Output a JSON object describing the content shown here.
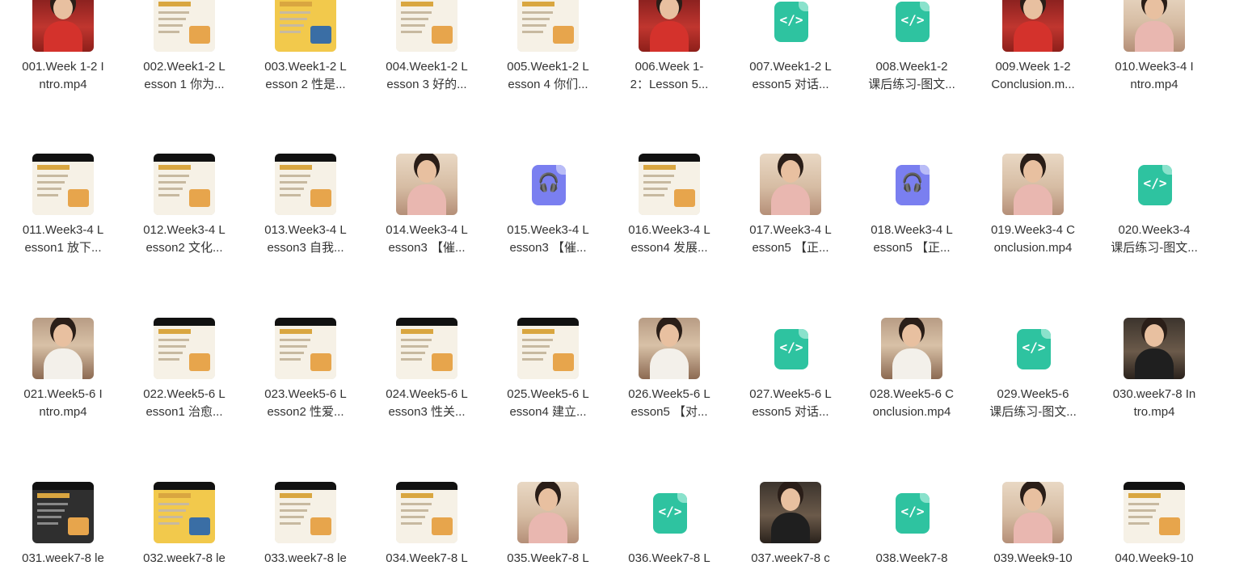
{
  "files": [
    {
      "line1": "001.Week 1-2 I",
      "line2": "ntro.mp4",
      "type": "video",
      "style": "person red"
    },
    {
      "line1": "002.Week1-2 L",
      "line2": "esson 1 你为...",
      "type": "video",
      "style": "slide"
    },
    {
      "line1": "003.Week1-2 L",
      "line2": "esson 2 性是...",
      "type": "video",
      "style": "slide yellow"
    },
    {
      "line1": "004.Week1-2 L",
      "line2": "esson 3 好的...",
      "type": "video",
      "style": "slide"
    },
    {
      "line1": "005.Week1-2 L",
      "line2": "esson 4 你们...",
      "type": "video",
      "style": "slide"
    },
    {
      "line1": "006.Week 1-",
      "line2": "2：Lesson 5...",
      "type": "video",
      "style": "person red"
    },
    {
      "line1": "007.Week1-2 L",
      "line2": "esson5 对话...",
      "type": "code"
    },
    {
      "line1": "008.Week1-2",
      "line2": "课后练习-图文...",
      "type": "code"
    },
    {
      "line1": "009.Week 1-2",
      "line2": "Conclusion.m...",
      "type": "video",
      "style": "person red"
    },
    {
      "line1": "010.Week3-4 I",
      "line2": "ntro.mp4",
      "type": "video",
      "style": "person light"
    },
    {
      "line1": "011.Week3-4 L",
      "line2": "esson1 放下...",
      "type": "video",
      "style": "slide"
    },
    {
      "line1": "012.Week3-4 L",
      "line2": "esson2 文化...",
      "type": "video",
      "style": "slide"
    },
    {
      "line1": "013.Week3-4 L",
      "line2": "esson3 自我...",
      "type": "video",
      "style": "slide"
    },
    {
      "line1": "014.Week3-4 L",
      "line2": "esson3 【催...",
      "type": "video",
      "style": "person light"
    },
    {
      "line1": "015.Week3-4 L",
      "line2": "esson3 【催...",
      "type": "audio"
    },
    {
      "line1": "016.Week3-4 L",
      "line2": "esson4 发展...",
      "type": "video",
      "style": "slide"
    },
    {
      "line1": "017.Week3-4 L",
      "line2": "esson5 【正...",
      "type": "video",
      "style": "person light"
    },
    {
      "line1": "018.Week3-4 L",
      "line2": "esson5 【正...",
      "type": "audio"
    },
    {
      "line1": "019.Week3-4 C",
      "line2": "onclusion.mp4",
      "type": "video",
      "style": "person light"
    },
    {
      "line1": "020.Week3-4",
      "line2": "课后练习-图文...",
      "type": "code"
    },
    {
      "line1": "021.Week5-6 I",
      "line2": "ntro.mp4",
      "type": "video",
      "style": "person"
    },
    {
      "line1": "022.Week5-6 L",
      "line2": "esson1 治愈...",
      "type": "video",
      "style": "slide"
    },
    {
      "line1": "023.Week5-6 L",
      "line2": "esson2 性爱...",
      "type": "video",
      "style": "slide"
    },
    {
      "line1": "024.Week5-6 L",
      "line2": "esson3 性关...",
      "type": "video",
      "style": "slide"
    },
    {
      "line1": "025.Week5-6 L",
      "line2": "esson4 建立...",
      "type": "video",
      "style": "slide"
    },
    {
      "line1": "026.Week5-6 L",
      "line2": "esson5 【对...",
      "type": "video",
      "style": "person"
    },
    {
      "line1": "027.Week5-6 L",
      "line2": "esson5 对话...",
      "type": "code"
    },
    {
      "line1": "028.Week5-6 C",
      "line2": "onclusion.mp4",
      "type": "video",
      "style": "person"
    },
    {
      "line1": "029.Week5-6",
      "line2": "课后练习-图文...",
      "type": "code"
    },
    {
      "line1": "030.week7-8 In",
      "line2": "tro.mp4",
      "type": "video",
      "style": "person dark"
    },
    {
      "line1": "031.week7-8 le",
      "line2": "",
      "type": "video",
      "style": "slide dark"
    },
    {
      "line1": "032.week7-8 le",
      "line2": "",
      "type": "video",
      "style": "slide yellow"
    },
    {
      "line1": "033.week7-8 le",
      "line2": "",
      "type": "video",
      "style": "slide"
    },
    {
      "line1": "034.Week7-8 L",
      "line2": "",
      "type": "video",
      "style": "slide"
    },
    {
      "line1": "035.Week7-8 L",
      "line2": "",
      "type": "video",
      "style": "person light"
    },
    {
      "line1": "036.Week7-8 L",
      "line2": "",
      "type": "code"
    },
    {
      "line1": "037.week7-8 c",
      "line2": "",
      "type": "video",
      "style": "person dark"
    },
    {
      "line1": "038.Week7-8",
      "line2": "",
      "type": "code"
    },
    {
      "line1": "039.Week9-10",
      "line2": "",
      "type": "video",
      "style": "person light"
    },
    {
      "line1": "040.Week9-10",
      "line2": "",
      "type": "video",
      "style": "slide"
    }
  ],
  "icons": {
    "code": "</>",
    "audio": "🎧"
  },
  "colors": {
    "code_icon": "#2ec3a0",
    "audio_icon": "#7a7ff0"
  }
}
